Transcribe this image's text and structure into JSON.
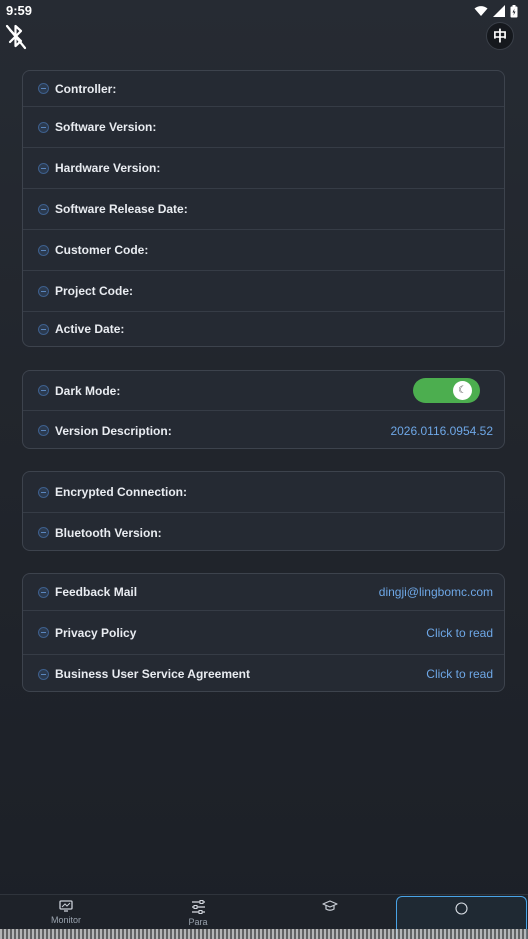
{
  "status_bar": {
    "time": "9:59"
  },
  "header": {
    "lang_label": "中"
  },
  "device_card": {
    "rows": [
      {
        "label": "Controller:",
        "value": ""
      },
      {
        "label": "Software Version:",
        "value": ""
      },
      {
        "label": "Hardware Version:",
        "value": ""
      },
      {
        "label": "Software Release Date:",
        "value": ""
      },
      {
        "label": "Customer Code:",
        "value": ""
      },
      {
        "label": "Project Code:",
        "value": ""
      },
      {
        "label": "Active Date:",
        "value": ""
      }
    ]
  },
  "settings_card": {
    "dark_mode": {
      "label": "Dark Mode:",
      "enabled": true,
      "knob_glyph": "☾"
    },
    "version_description": {
      "label": "Version Description:",
      "value": "2026.0116.0954.52"
    }
  },
  "connection_card": {
    "encrypted": {
      "label": "Encrypted Connection:",
      "value": ""
    },
    "bluetooth": {
      "label": "Bluetooth Version:",
      "value": ""
    }
  },
  "info_card": {
    "feedback": {
      "label": "Feedback Mail",
      "value": "dingji@lingbomc.com"
    },
    "privacy": {
      "label": "Privacy Policy",
      "value": "Click to read"
    },
    "agreement": {
      "label": "Business User Service Agreement",
      "value": "Click to read"
    }
  },
  "bottom_nav": {
    "items": [
      {
        "label": "Monitor",
        "icon": "monitor-icon"
      },
      {
        "label": "Para",
        "icon": "sliders-icon"
      },
      {
        "label": "",
        "icon": "graduation-cap-icon"
      },
      {
        "label": "",
        "icon": "info-icon"
      }
    ]
  },
  "colors": {
    "accent": "#6ea7e6",
    "toggle_on": "#4cae4f",
    "active_tab_border": "#49a3e6"
  }
}
